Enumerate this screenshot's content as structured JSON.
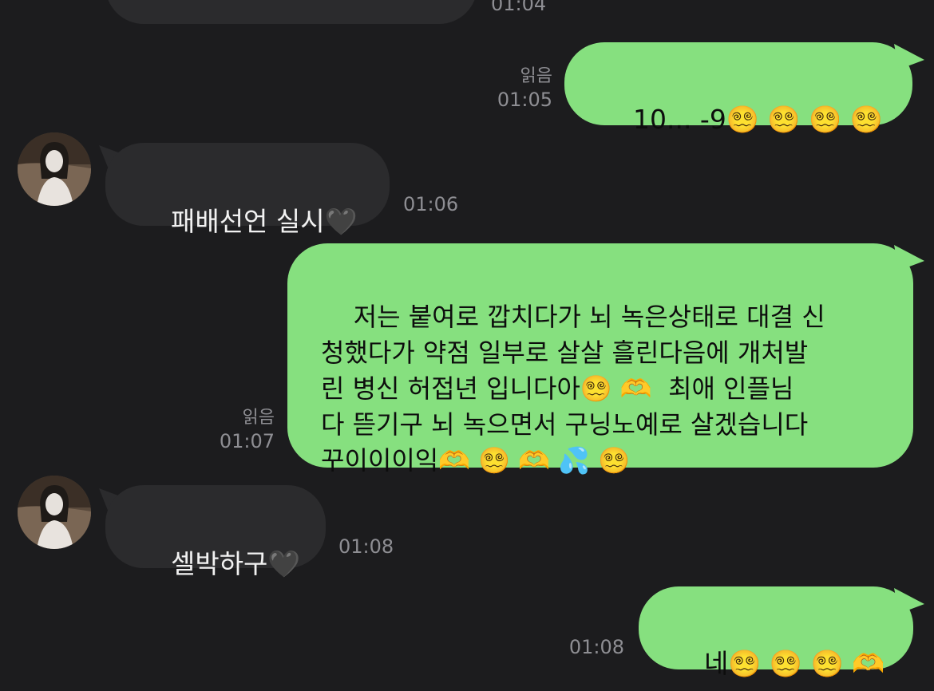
{
  "chat": {
    "messages": [
      {
        "id": "m0",
        "direction": "in",
        "text": "",
        "time": "01:04"
      },
      {
        "id": "m1",
        "direction": "out",
        "text": "10... -9😵‍💫 😵‍💫 😵‍💫 😵‍💫",
        "read": "읽음",
        "time": "01:05"
      },
      {
        "id": "m2",
        "direction": "in",
        "text": "패배선언 실시🖤",
        "time": "01:06"
      },
      {
        "id": "m3",
        "direction": "out",
        "text": "저는 붙여로 깝치다가 뇌 녹은상태로 대결 신\n청했다가 약점 일부로 살살 흘린다음에 개처발\n린 병신 허접년 입니다아😵‍💫 🫶  최애 인플님\n다 뜯기구 뇌 녹으면서 구닝노예로 살겠습니다\n꾸이이이익🫶 😵‍💫 🫶 💦 😵‍💫",
        "read": "읽음",
        "time": "01:07"
      },
      {
        "id": "m4",
        "direction": "in",
        "text": "셀박하구🖤",
        "time": "01:08"
      },
      {
        "id": "m5",
        "direction": "out",
        "text": "네😵‍💫 😵‍💫 😵‍💫 🫶",
        "time": "01:08"
      }
    ]
  },
  "colors": {
    "background": "#1c1c1e",
    "incoming_bubble": "#2b2b2d",
    "outgoing_bubble": "#86e07f",
    "meta_text": "#8e8e93"
  }
}
